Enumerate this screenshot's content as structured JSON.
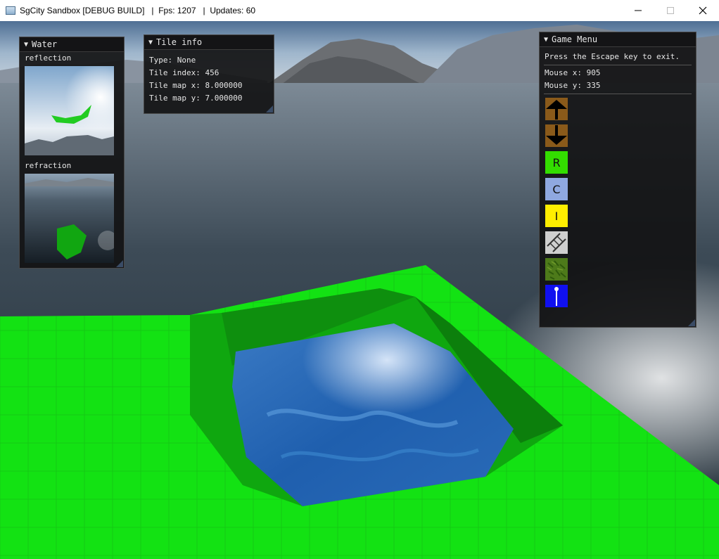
{
  "window": {
    "app_icon": "app-window-icon",
    "title": "SgCity Sandbox [DEBUG BUILD]   |  Fps: 1207   |  Updates: 60",
    "controls": [
      "minimize-icon",
      "maximize-icon",
      "close-icon"
    ]
  },
  "water_panel": {
    "title": "Water",
    "reflection_label": "reflection",
    "refraction_label": "refraction"
  },
  "tile_info": {
    "title": "Tile info",
    "type": "Type: None",
    "index": "Tile index: 456",
    "map_x": "Tile map x: 8.000000",
    "map_y": "Tile map y: 7.000000"
  },
  "game_menu": {
    "title": "Game Menu",
    "hint": "Press the Escape key to exit.",
    "mouse_x": "Mouse x: 905",
    "mouse_y": "Mouse y: 335",
    "tools": [
      {
        "name": "raise-terrain-button",
        "icon": "arrow-up-icon",
        "label": "",
        "color": "#8a5a1a"
      },
      {
        "name": "lower-terrain-button",
        "icon": "arrow-down-icon",
        "label": "",
        "color": "#8a5a1a"
      },
      {
        "name": "residential-zone-button",
        "icon": "",
        "label": "R",
        "color": "#33dd00"
      },
      {
        "name": "commercial-zone-button",
        "icon": "",
        "label": "C",
        "color": "#8fa8e0"
      },
      {
        "name": "industrial-zone-button",
        "icon": "",
        "label": "I",
        "color": "#ffee00"
      },
      {
        "name": "road-tool-button",
        "icon": "road-ladder-icon",
        "label": "",
        "color": "#cfcfcf"
      },
      {
        "name": "grass-tool-button",
        "icon": "grass-texture-icon",
        "label": "",
        "color": "#4d7a1a"
      },
      {
        "name": "power-line-button",
        "icon": "power-pole-icon",
        "label": "",
        "color": "#1010f0"
      }
    ]
  }
}
